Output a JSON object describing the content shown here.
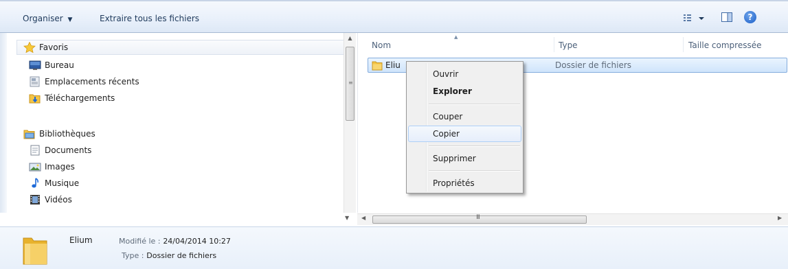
{
  "toolbar": {
    "organise_label": "Organiser",
    "extract_label": "Extraire tous les fichiers",
    "help_glyph": "?"
  },
  "nav": {
    "favorites_label": "Favoris",
    "favorites": [
      {
        "label": "Bureau",
        "icon": "desktop-icon"
      },
      {
        "label": "Emplacements récents",
        "icon": "recent-places-icon"
      },
      {
        "label": "Téléchargements",
        "icon": "downloads-folder-icon"
      }
    ],
    "libraries_label": "Bibliothèques",
    "libraries": [
      {
        "label": "Documents",
        "icon": "documents-icon"
      },
      {
        "label": "Images",
        "icon": "pictures-icon"
      },
      {
        "label": "Musique",
        "icon": "music-icon"
      },
      {
        "label": "Vidéos",
        "icon": "videos-icon"
      }
    ]
  },
  "content": {
    "columns": [
      "Nom",
      "Type",
      "Taille compressée"
    ],
    "rows": [
      {
        "name": "Eliu",
        "type": "Dossier de fichiers"
      }
    ]
  },
  "context_menu": {
    "items": [
      {
        "label": "Ouvrir"
      },
      {
        "label": "Explorer"
      },
      {
        "label": "Couper"
      },
      {
        "label": "Copier"
      },
      {
        "label": "Supprimer"
      },
      {
        "label": "Propriétés"
      }
    ]
  },
  "details": {
    "name": "Elium",
    "modified_label": "Modifié le :",
    "modified_value": "24/04/2014 10:27",
    "type_label": "Type :",
    "type_value": "Dossier de fichiers"
  },
  "scrollbars": {
    "horizontal_grip": "III"
  },
  "colors": {
    "selection_border": "#84acdd",
    "folder_yellow": "#f4c445",
    "toolbar_text": "#1e395b"
  }
}
